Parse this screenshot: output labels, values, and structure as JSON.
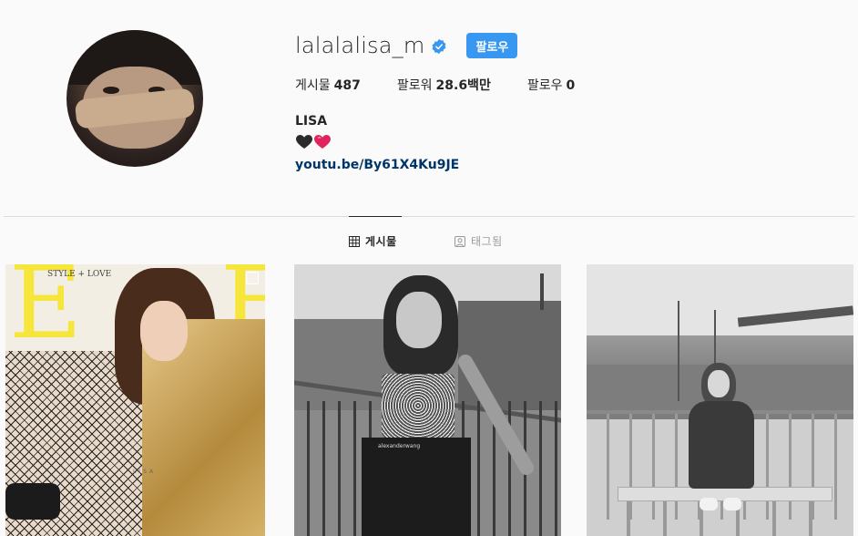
{
  "profile": {
    "username": "lalalalisa_m",
    "verified": true,
    "follow_label": "팔로우",
    "stats": {
      "posts_label": "게시물",
      "posts_value": "487",
      "followers_label": "팔로워",
      "followers_value": "28.6백만",
      "following_label": "팔로우",
      "following_value": "0"
    },
    "full_name": "LISA",
    "bio_emoji": "🖤❤️",
    "bio_link": "youtu.be/By61X4Ku9JE"
  },
  "tabs": [
    {
      "label": "게시물",
      "icon": "grid-icon",
      "active": true
    },
    {
      "label": "태그됨",
      "icon": "tagged-icon",
      "active": false
    }
  ],
  "posts": [
    {
      "kind": "magazine-cover",
      "cover_title": "ELLE",
      "cover_sub": "STYLE + LOVE",
      "cover_name": "LISA",
      "multi": true
    },
    {
      "kind": "city-photo-bw",
      "belt_text": "alexanderwang"
    },
    {
      "kind": "rooftop-photo-bw"
    }
  ],
  "colors": {
    "accent": "#3897f0",
    "link": "#003569",
    "verified": "#3897f0",
    "background": "#fafafa"
  }
}
